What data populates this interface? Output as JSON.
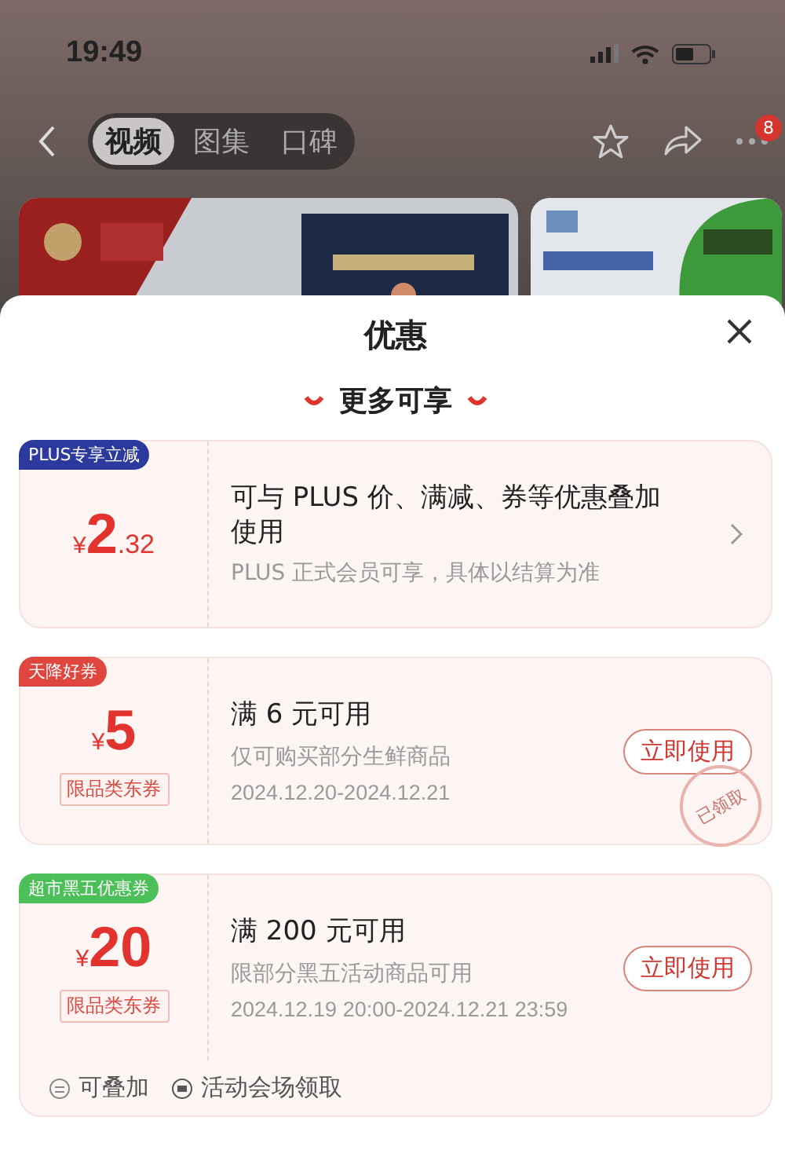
{
  "status_bar": {
    "time": "19:49"
  },
  "nav": {
    "tabs": [
      {
        "label": "视频",
        "selected": true
      },
      {
        "label": "图集",
        "selected": false
      },
      {
        "label": "口碑",
        "selected": false
      }
    ],
    "more_badge": "8"
  },
  "sheet": {
    "title": "优惠",
    "subtitle": "更多可享",
    "coupons": [
      {
        "kind": "plus",
        "badge": "PLUS专享立减",
        "color": "#2b3a9c",
        "currency": "¥",
        "amount": "2",
        "decimals": ".32",
        "title": "可与 PLUS 价、满减、券等优惠叠加使用",
        "desc": "PLUS 正式会员可享，具体以结算为准"
      },
      {
        "kind": "coupon",
        "badge": "天降好券",
        "color": "#e0463e",
        "currency": "¥",
        "amount": "5",
        "tag": "限品类东券",
        "title": "满 6 元可用",
        "desc": "仅可购买部分生鲜商品",
        "dates": "2024.12.20-2024.12.21",
        "button": "立即使用",
        "stamp": "已领取"
      },
      {
        "kind": "coupon",
        "badge": "超市黑五优惠券",
        "color": "#4cbf58",
        "currency": "¥",
        "amount": "20",
        "tag": "限品类东券",
        "title": "满 200 元可用",
        "desc": "限部分黑五活动商品可用",
        "dates": "2024.12.19 20:00-2024.12.21 23:59",
        "button": "立即使用",
        "notes": [
          "可叠加",
          "活动会场领取"
        ]
      }
    ]
  }
}
